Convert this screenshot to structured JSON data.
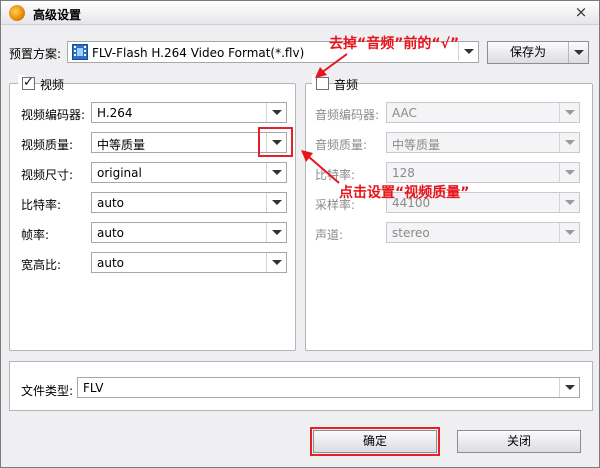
{
  "window": {
    "title": "高级设置",
    "close": "×"
  },
  "preset": {
    "label": "预置方案:",
    "value": "FLV-Flash H.264 Video Format(*.flv)",
    "save_as": "保存为"
  },
  "video": {
    "title": "视频",
    "checked": true,
    "fields": [
      {
        "label": "视频编码器:",
        "value": "H.264"
      },
      {
        "label": "视频质量:",
        "value": "中等质量"
      },
      {
        "label": "视频尺寸:",
        "value": "original"
      },
      {
        "label": "比特率:",
        "value": "auto"
      },
      {
        "label": "帧率:",
        "value": "auto"
      },
      {
        "label": "宽高比:",
        "value": "auto"
      }
    ]
  },
  "audio": {
    "title": "音频",
    "checked": false,
    "fields": [
      {
        "label": "音频编码器:",
        "value": "AAC"
      },
      {
        "label": "音频质量:",
        "value": "中等质量"
      },
      {
        "label": "比特率:",
        "value": "128"
      },
      {
        "label": "采样率:",
        "value": "44100"
      },
      {
        "label": "声道:",
        "value": "stereo"
      }
    ]
  },
  "file_type": {
    "label": "文件类型:",
    "value": "FLV"
  },
  "buttons": {
    "ok": "确定",
    "close": "关闭"
  },
  "annotations": {
    "top": "去掉“音频”前的“√”",
    "middle": "点击设置“视频质量”"
  },
  "colors": {
    "annotation": "#e8131b"
  }
}
